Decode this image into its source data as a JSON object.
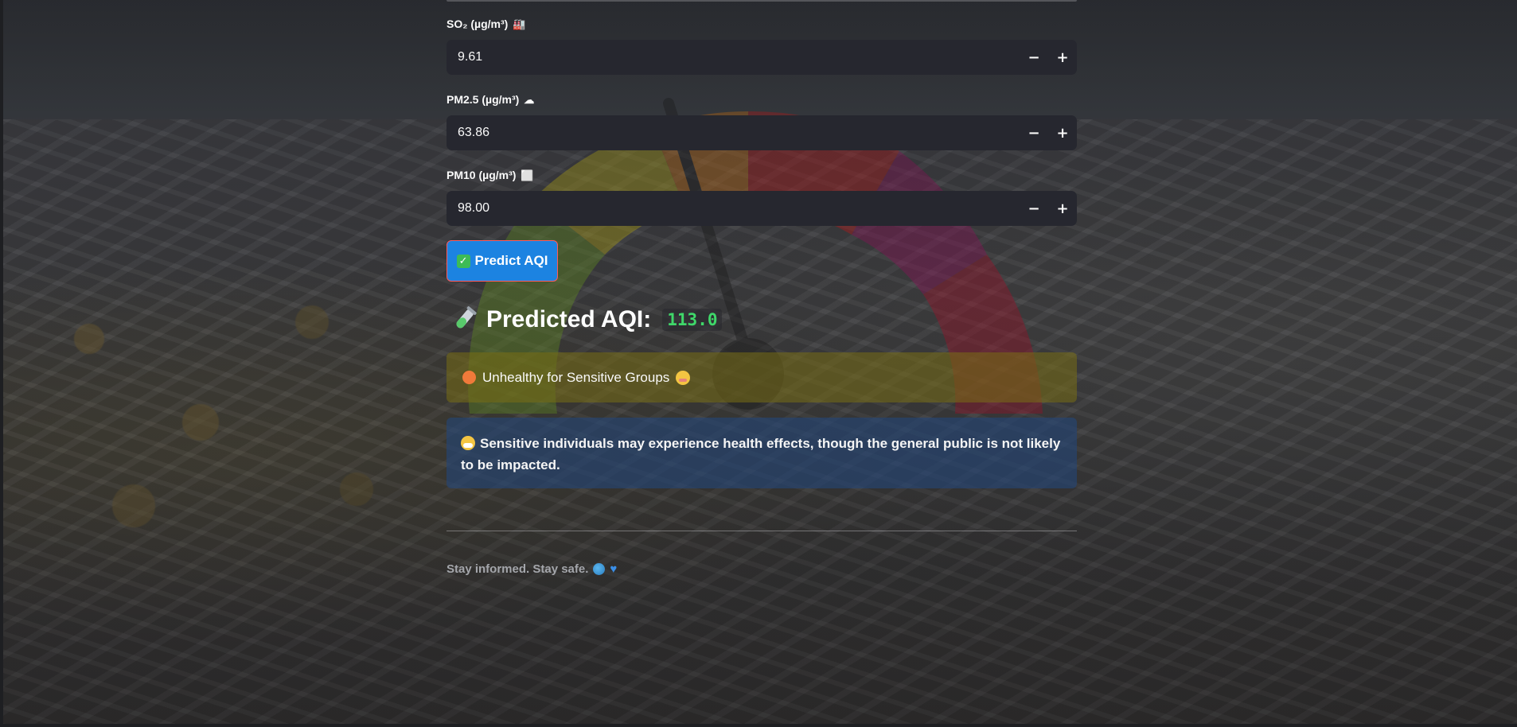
{
  "fields": [
    {
      "label": "SO₂ (µg/m³)",
      "icon": "factory-icon",
      "value": "9.61"
    },
    {
      "label": "PM2.5 (µg/m³)",
      "icon": "cloud-icon",
      "value": "63.86"
    },
    {
      "label": "PM10 (µg/m³)",
      "icon": "square-icon",
      "value": "98.00"
    }
  ],
  "stepper": {
    "minus": "−",
    "plus": "+"
  },
  "predict_button": {
    "label": "Predict AQI",
    "icon": "check-box-icon"
  },
  "result": {
    "title": "Predicted AQI:",
    "value": "113.0",
    "icon": "test-tube-icon",
    "value_color": "#3fd86a"
  },
  "category": {
    "text": "Unhealthy for Sensitive Groups",
    "dot_color": "#f07a3a",
    "icon": "face-icon"
  },
  "advice": {
    "text": "Sensitive individuals may experience health effects, though the general public is not likely to be impacted.",
    "icon": "mask-face-icon"
  },
  "footer": {
    "text": "Stay informed. Stay safe.",
    "icons": [
      "globe-icon",
      "blue-heart-icon"
    ]
  },
  "colors": {
    "button_bg": "#1c83e1",
    "button_border": "#ff5b5b",
    "input_bg": "#26272f",
    "category_bg": "#787014",
    "advice_bg": "#234678"
  }
}
